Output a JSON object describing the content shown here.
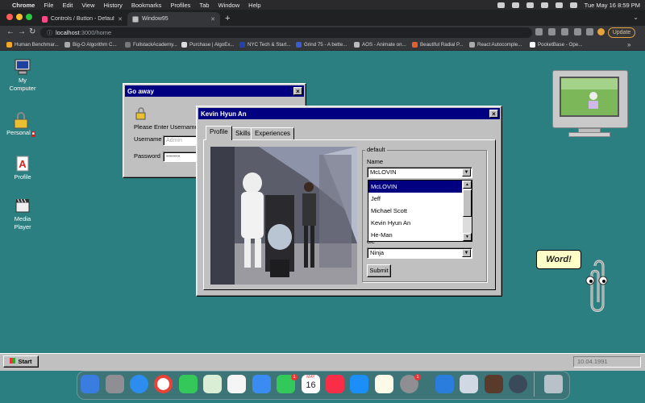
{
  "menubar": {
    "app": "Chrome",
    "items": [
      "File",
      "Edit",
      "View",
      "History",
      "Bookmarks",
      "Profiles",
      "Tab",
      "Window",
      "Help"
    ],
    "datetime": "Tue May 16  8:59 PM"
  },
  "browser": {
    "tabs": [
      {
        "title": "Controls / Button - Default - S"
      },
      {
        "title": "Window95"
      }
    ],
    "url_host": "localhost",
    "url_path": ":3000/home",
    "update_label": "Update",
    "bookmarks": [
      "Human Benchmar...",
      "Big-O Algorithm C...",
      "FullstackAcademy...",
      "Purchase | AlgoEx...",
      "NYC Tech & Start...",
      "Grind 75 - A bette...",
      "AOS - Animate on...",
      "Beautiful Radial P...",
      "React Autocomple...",
      "PocketBase - Ope..."
    ]
  },
  "desktop": {
    "icons": [
      {
        "label": "My Computer",
        "icon": "computer-icon"
      },
      {
        "label": "Personal",
        "icon": "lock-icon"
      },
      {
        "label": "Profile",
        "icon": "acrobat-icon"
      },
      {
        "label": "Media Player",
        "icon": "clapper-icon"
      }
    ]
  },
  "login_window": {
    "title": "Go away",
    "prompt": "Please Enter Username",
    "username_label": "Username",
    "username_placeholder": "Admin",
    "password_label": "Password",
    "password_value": "•••••••"
  },
  "profile_window": {
    "title": "Kevin Hyun An",
    "tabs": [
      "Profile",
      "Skills",
      "Experiences"
    ],
    "group_label": "default",
    "name_label": "Name",
    "name_value": "McLOVIN",
    "name_options": [
      "McLOVIN",
      "Jeff",
      "Michael Scott",
      "Kevin Hyun An",
      "He-Man"
    ],
    "role_label": "ole",
    "role_value": "Ninja",
    "submit_label": "Submit"
  },
  "taskbar": {
    "start_label": "Start",
    "clock": "10.04.1991"
  },
  "clippy": {
    "bubble": "Word!"
  },
  "dock": {
    "calendar_month": "MAY",
    "calendar_day": "16",
    "facetime_badge": "1",
    "settings_badge": "1"
  }
}
